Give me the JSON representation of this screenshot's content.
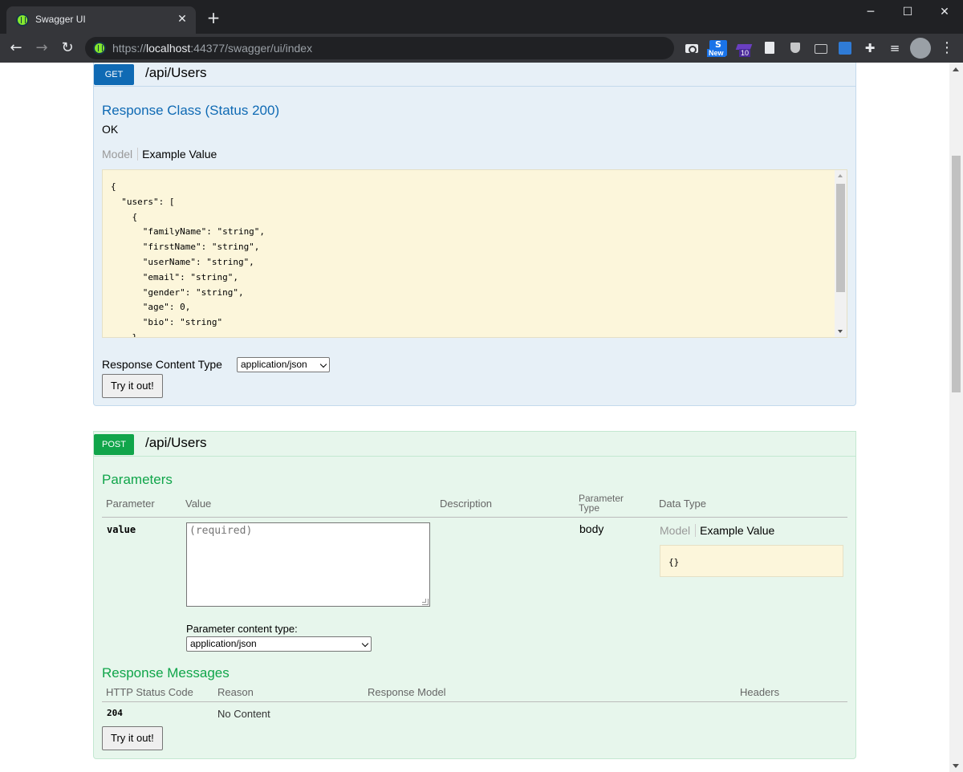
{
  "browser": {
    "tab_title": "Swagger UI",
    "tab_close": "✕",
    "new_tab": "+",
    "url_scheme": "https://",
    "url_host": "localhost",
    "url_rest": ":44377/swagger/ui/index",
    "extension_new_badge": "New",
    "extension_count_badge": "10",
    "window_minimize": "─",
    "window_maximize": "☐",
    "window_close": "✕"
  },
  "get_op": {
    "method": "GET",
    "path": "/api/Users",
    "response_class_title": "Response Class (Status 200)",
    "response_status_text": "OK",
    "model_tab": "Model",
    "example_tab": "Example Value",
    "example_json": "{\n  \"users\": [\n    {\n      \"familyName\": \"string\",\n      \"firstName\": \"string\",\n      \"userName\": \"string\",\n      \"email\": \"string\",\n      \"gender\": \"string\",\n      \"age\": 0,\n      \"bio\": \"string\"\n    }",
    "content_type_label": "Response Content Type",
    "content_type_value": "application/json",
    "try_button": "Try it out!"
  },
  "post_op": {
    "method": "POST",
    "path": "/api/Users",
    "parameters_title": "Parameters",
    "param_headers": {
      "parameter": "Parameter",
      "value": "Value",
      "description": "Description",
      "parameter_type": "Parameter\nType",
      "data_type": "Data Type"
    },
    "param_row": {
      "name": "value",
      "placeholder": "(required)",
      "param_type": "body",
      "model_tab": "Model",
      "example_tab": "Example Value",
      "example_json": "{}"
    },
    "param_content_type_label": "Parameter content type:",
    "param_content_type_value": "application/json",
    "response_messages_title": "Response Messages",
    "response_headers": {
      "status_code": "HTTP Status Code",
      "reason": "Reason",
      "response_model": "Response Model",
      "headers": "Headers"
    },
    "response_row": {
      "status_code": "204",
      "reason": "No Content"
    },
    "try_button": "Try it out!"
  }
}
